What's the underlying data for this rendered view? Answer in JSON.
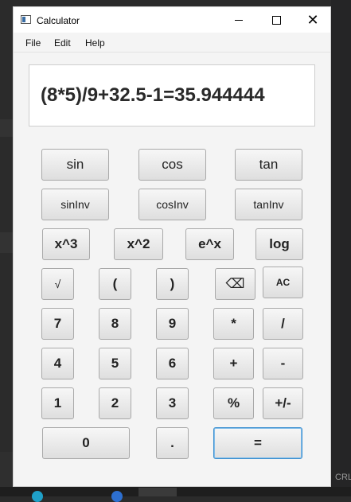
{
  "window": {
    "title": "Calculator"
  },
  "menu": [
    "File",
    "Edit",
    "Help"
  ],
  "display": {
    "expression": "(8*5)/9+32.5-1=35.944444"
  },
  "buttons": {
    "sin": "sin",
    "cos": "cos",
    "tan": "tan",
    "sinInv": "sinInv",
    "cosInv": "cosInv",
    "tanInv": "tanInv",
    "cube": "x^3",
    "square": "x^2",
    "exp": "e^x",
    "log": "log",
    "sqrt": "√",
    "lparen": "(",
    "rparen": ")",
    "backspace": "⌫",
    "ac": "AC",
    "d7": "7",
    "d8": "8",
    "d9": "9",
    "mul": "*",
    "div": "/",
    "d4": "4",
    "d5": "5",
    "d6": "6",
    "add": "+",
    "sub": "-",
    "d1": "1",
    "d2": "2",
    "d3": "3",
    "pct": "%",
    "neg": "+/-",
    "d0": "0",
    "dot": ".",
    "eq": "="
  },
  "background": {
    "corner_text": "CRL"
  }
}
